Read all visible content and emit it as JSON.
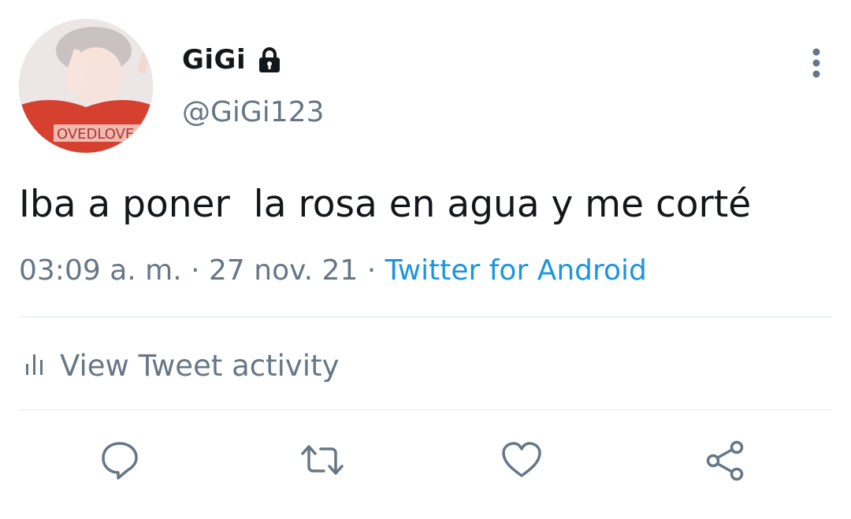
{
  "author": {
    "display_name": "GiGi",
    "handle": "@GiGi123",
    "protected": true,
    "avatar_shirt_text": "OVEDLOVE"
  },
  "tweet": {
    "text": "Iba a poner  la rosa en agua y me corté",
    "time": "03:09 a. m.",
    "separator": " · ",
    "date": "27 nov. 21",
    "source": "Twitter for Android"
  },
  "activity": {
    "label": "View Tweet activity",
    "icon": "bar-chart-icon"
  },
  "actions": [
    {
      "name": "reply",
      "icon": "comment-icon"
    },
    {
      "name": "retweet",
      "icon": "retweet-icon"
    },
    {
      "name": "like",
      "icon": "heart-icon"
    },
    {
      "name": "share",
      "icon": "share-icon"
    }
  ],
  "colors": {
    "text": "#14171a",
    "secondary": "#657786",
    "link": "#1b95e0",
    "divider": "#e1e8ed"
  }
}
